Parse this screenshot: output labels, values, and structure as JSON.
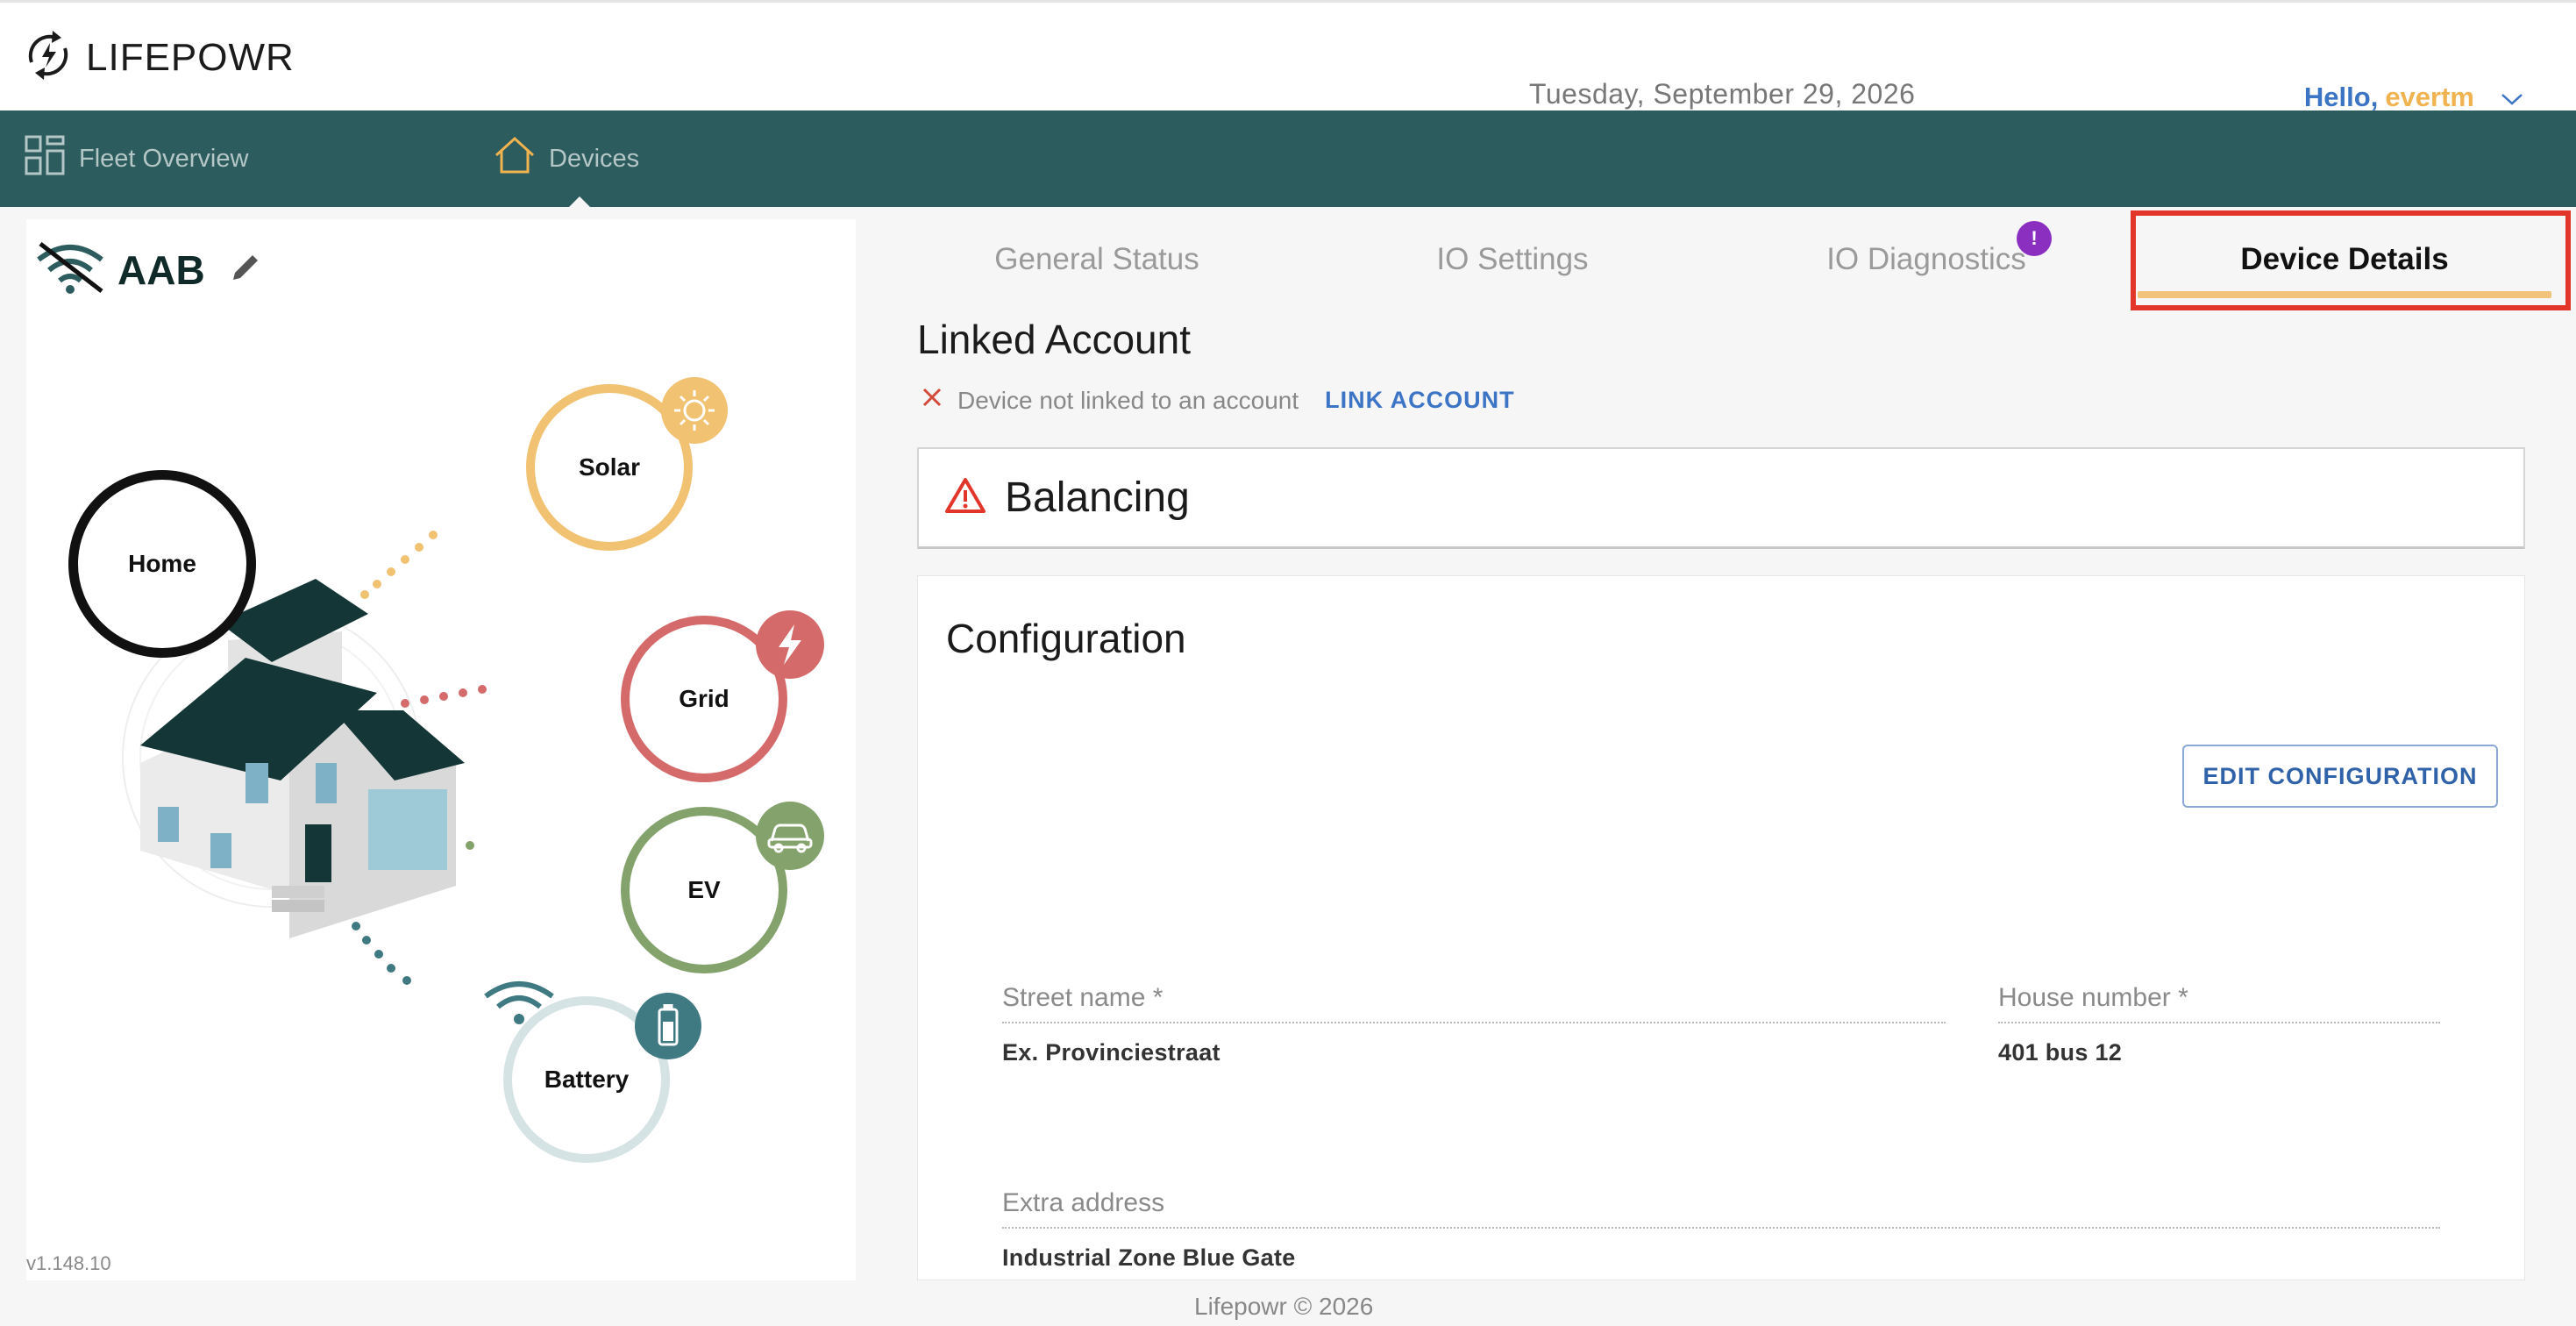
{
  "app": {
    "name": "LIFEPOWR",
    "date": "Tuesday, September 29, 2026"
  },
  "user": {
    "hello": "Hello,",
    "name": "evertm"
  },
  "nav": {
    "items": [
      {
        "label": "Fleet Overview",
        "icon": "grid-icon"
      },
      {
        "label": "Devices",
        "icon": "home-icon"
      }
    ],
    "active": "Devices"
  },
  "device": {
    "name": "AAB",
    "connection": "offline",
    "version": "v1.148.10",
    "nodes": {
      "home": "Home",
      "solar": "Solar",
      "grid": "Grid",
      "ev": "EV",
      "battery": "Battery"
    }
  },
  "tabs": {
    "items": [
      "General Status",
      "IO Settings",
      "IO Diagnostics",
      "Device Details"
    ],
    "active": "Device Details",
    "diagnostics_badge": "!"
  },
  "linked_account": {
    "title": "Linked Account",
    "status": "Device not linked to an account",
    "link_button": "LINK ACCOUNT"
  },
  "balancing": {
    "title": "Balancing"
  },
  "configuration": {
    "title": "Configuration",
    "edit_button": "EDIT CONFIGURATION",
    "fields": {
      "street": {
        "label": "Street name *",
        "value": "Ex. Provinciestraat"
      },
      "house_number": {
        "label": "House number *",
        "value": "401 bus 12"
      },
      "extra_address": {
        "label": "Extra address",
        "value": "Industrial Zone Blue Gate"
      }
    }
  },
  "footer": {
    "text": "Lifepowr © 2026"
  },
  "colors": {
    "nav_bg": "#2c5c5d",
    "solar": "#f0c271",
    "grid": "#d46a6a",
    "ev": "#84a26b",
    "battery": "#3f7a82",
    "accent": "#3b74c4",
    "highlight": "#e2362a"
  }
}
